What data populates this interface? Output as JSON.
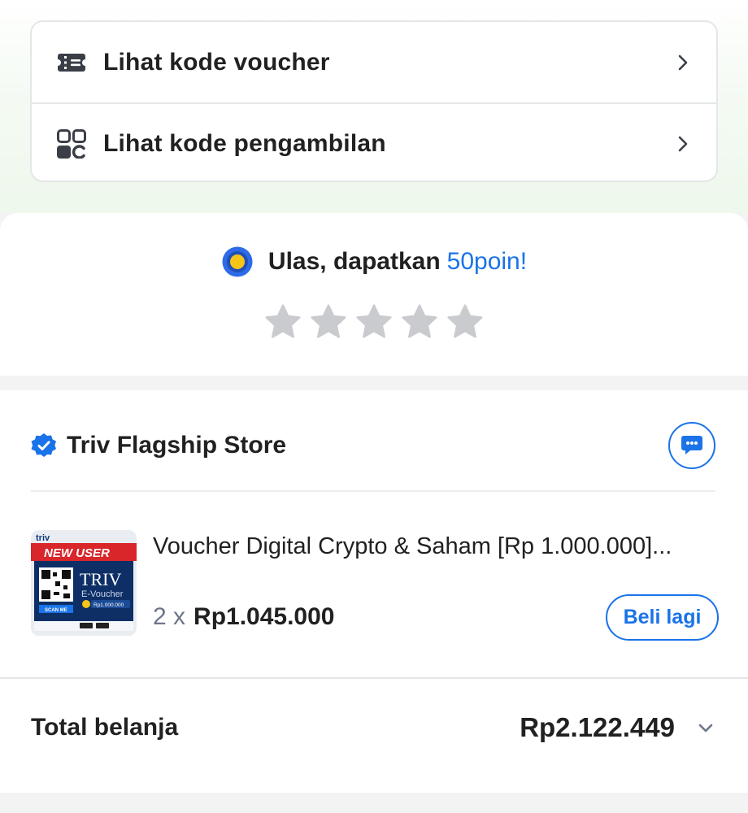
{
  "codes": {
    "voucher_label": "Lihat kode voucher",
    "pickup_label": "Lihat kode pengambilan"
  },
  "review": {
    "prefix": "Ulas, dapatkan",
    "points": "50poin",
    "suffix": "!",
    "rating": 0,
    "max_rating": 5
  },
  "order": {
    "store_name": "Triv Flagship Store",
    "product": {
      "title": "Voucher Digital Crypto & Saham [Rp 1.000.000]...",
      "quantity": "2 x",
      "price": "Rp1.045.000",
      "thumb_brand": "triv",
      "thumb_badge": "NEW USER",
      "thumb_title": "TRIV",
      "thumb_subtitle": "E-Voucher",
      "thumb_amount": "Rp1.000.000",
      "thumb_scan": "SCAN ME"
    },
    "buy_again_label": "Beli lagi",
    "total_label": "Total belanja",
    "total_value": "Rp2.122.449"
  },
  "colors": {
    "accent_blue": "#1a73e8",
    "coin_yellow": "#f5c518",
    "star_inactive": "#c9cbcf",
    "text_primary": "#212121"
  },
  "icons": {
    "voucher": "ticket-icon",
    "pickup": "qr-code-icon",
    "coin": "coin-icon",
    "verified": "verified-badge-icon",
    "chat": "chat-icon"
  }
}
